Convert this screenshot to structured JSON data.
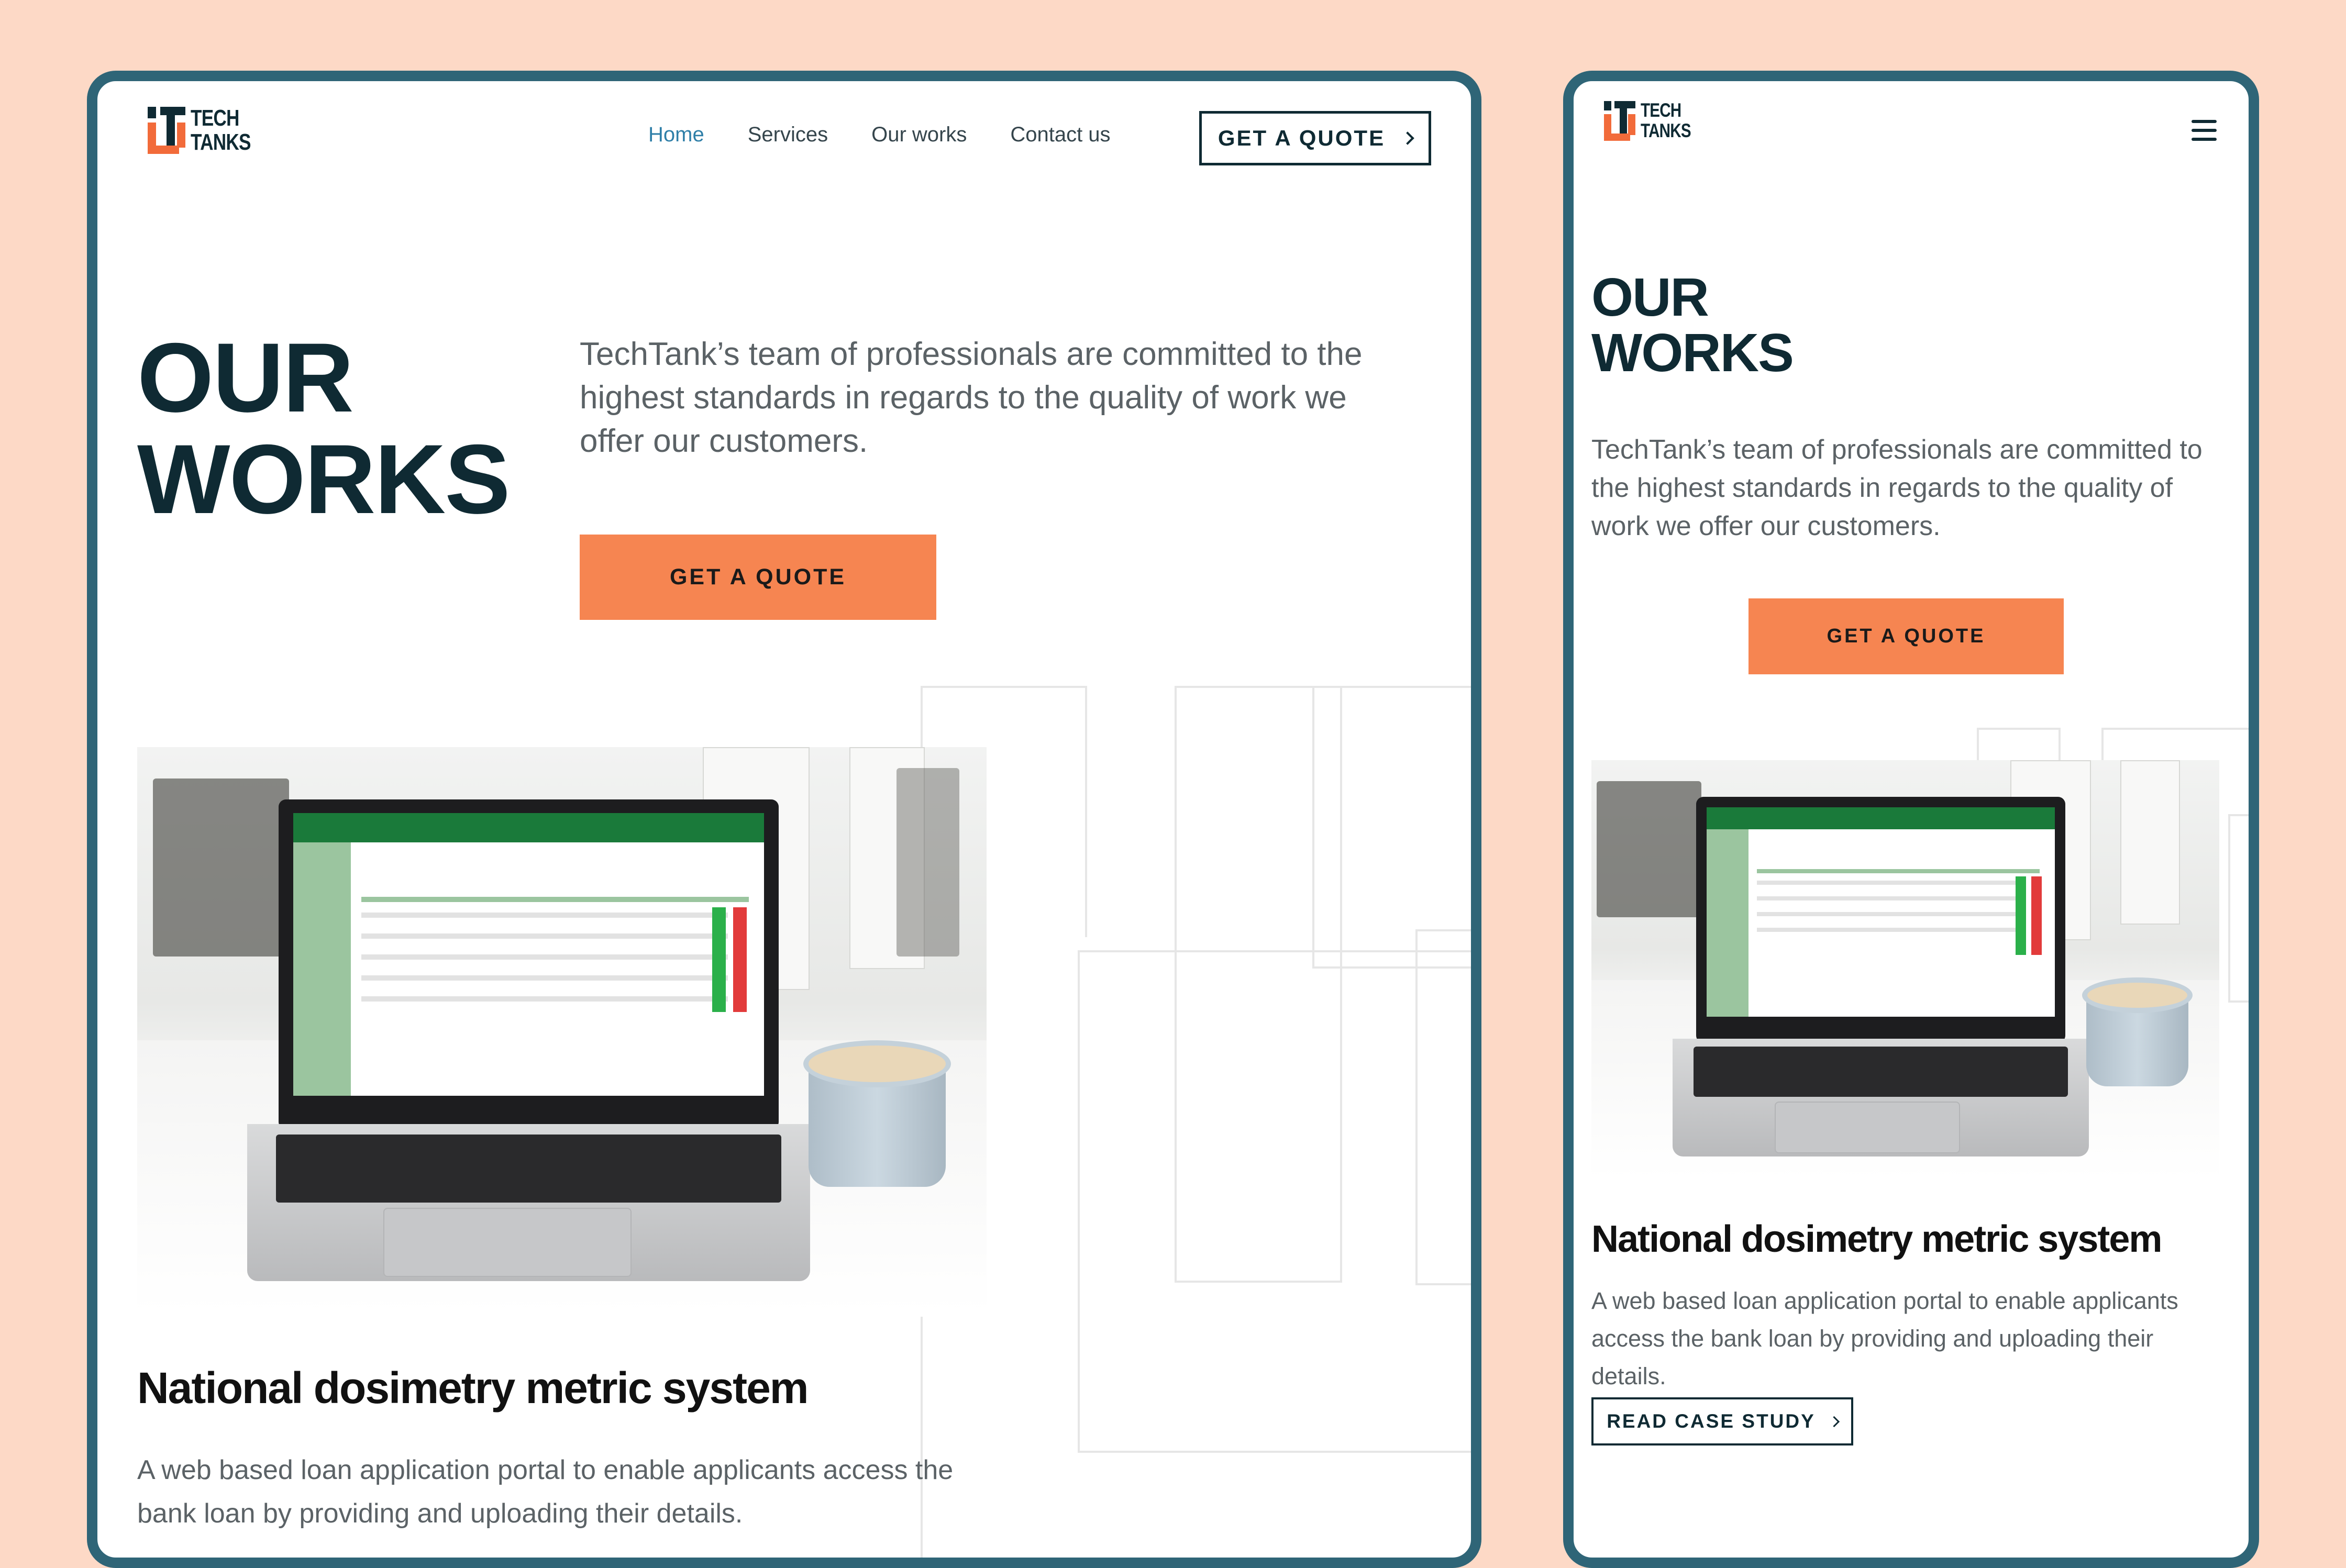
{
  "logo": {
    "line1": "TECH",
    "line2": "TANKS"
  },
  "nav": {
    "items": [
      {
        "label": "Home",
        "active": true
      },
      {
        "label": "Services",
        "active": false
      },
      {
        "label": "Our works",
        "active": false
      },
      {
        "label": "Contact us",
        "active": false
      }
    ],
    "cta_label": "GET A QUOTE"
  },
  "hero": {
    "title_line1": "OUR",
    "title_line2": "WORKS",
    "description": "TechTank’s team of professionals are committed to the highest standards in regards to the quality of work we offer our customers.",
    "cta_label": "GET A QUOTE"
  },
  "work": {
    "title": "National dosimetry metric system",
    "description": "A web based loan application portal to enable applicants access the bank loan by providing and uploading their details.",
    "read_label": "READ CASE STUDY"
  },
  "colors": {
    "background": "#fdd9c6",
    "frame": "#2f6577",
    "accent": "#f68551",
    "nav_active": "#2f7fa8",
    "heading": "#0f2a33"
  },
  "icons": [
    "chevron-right-icon",
    "hamburger-menu-icon",
    "techtanks-logo-icon"
  ]
}
